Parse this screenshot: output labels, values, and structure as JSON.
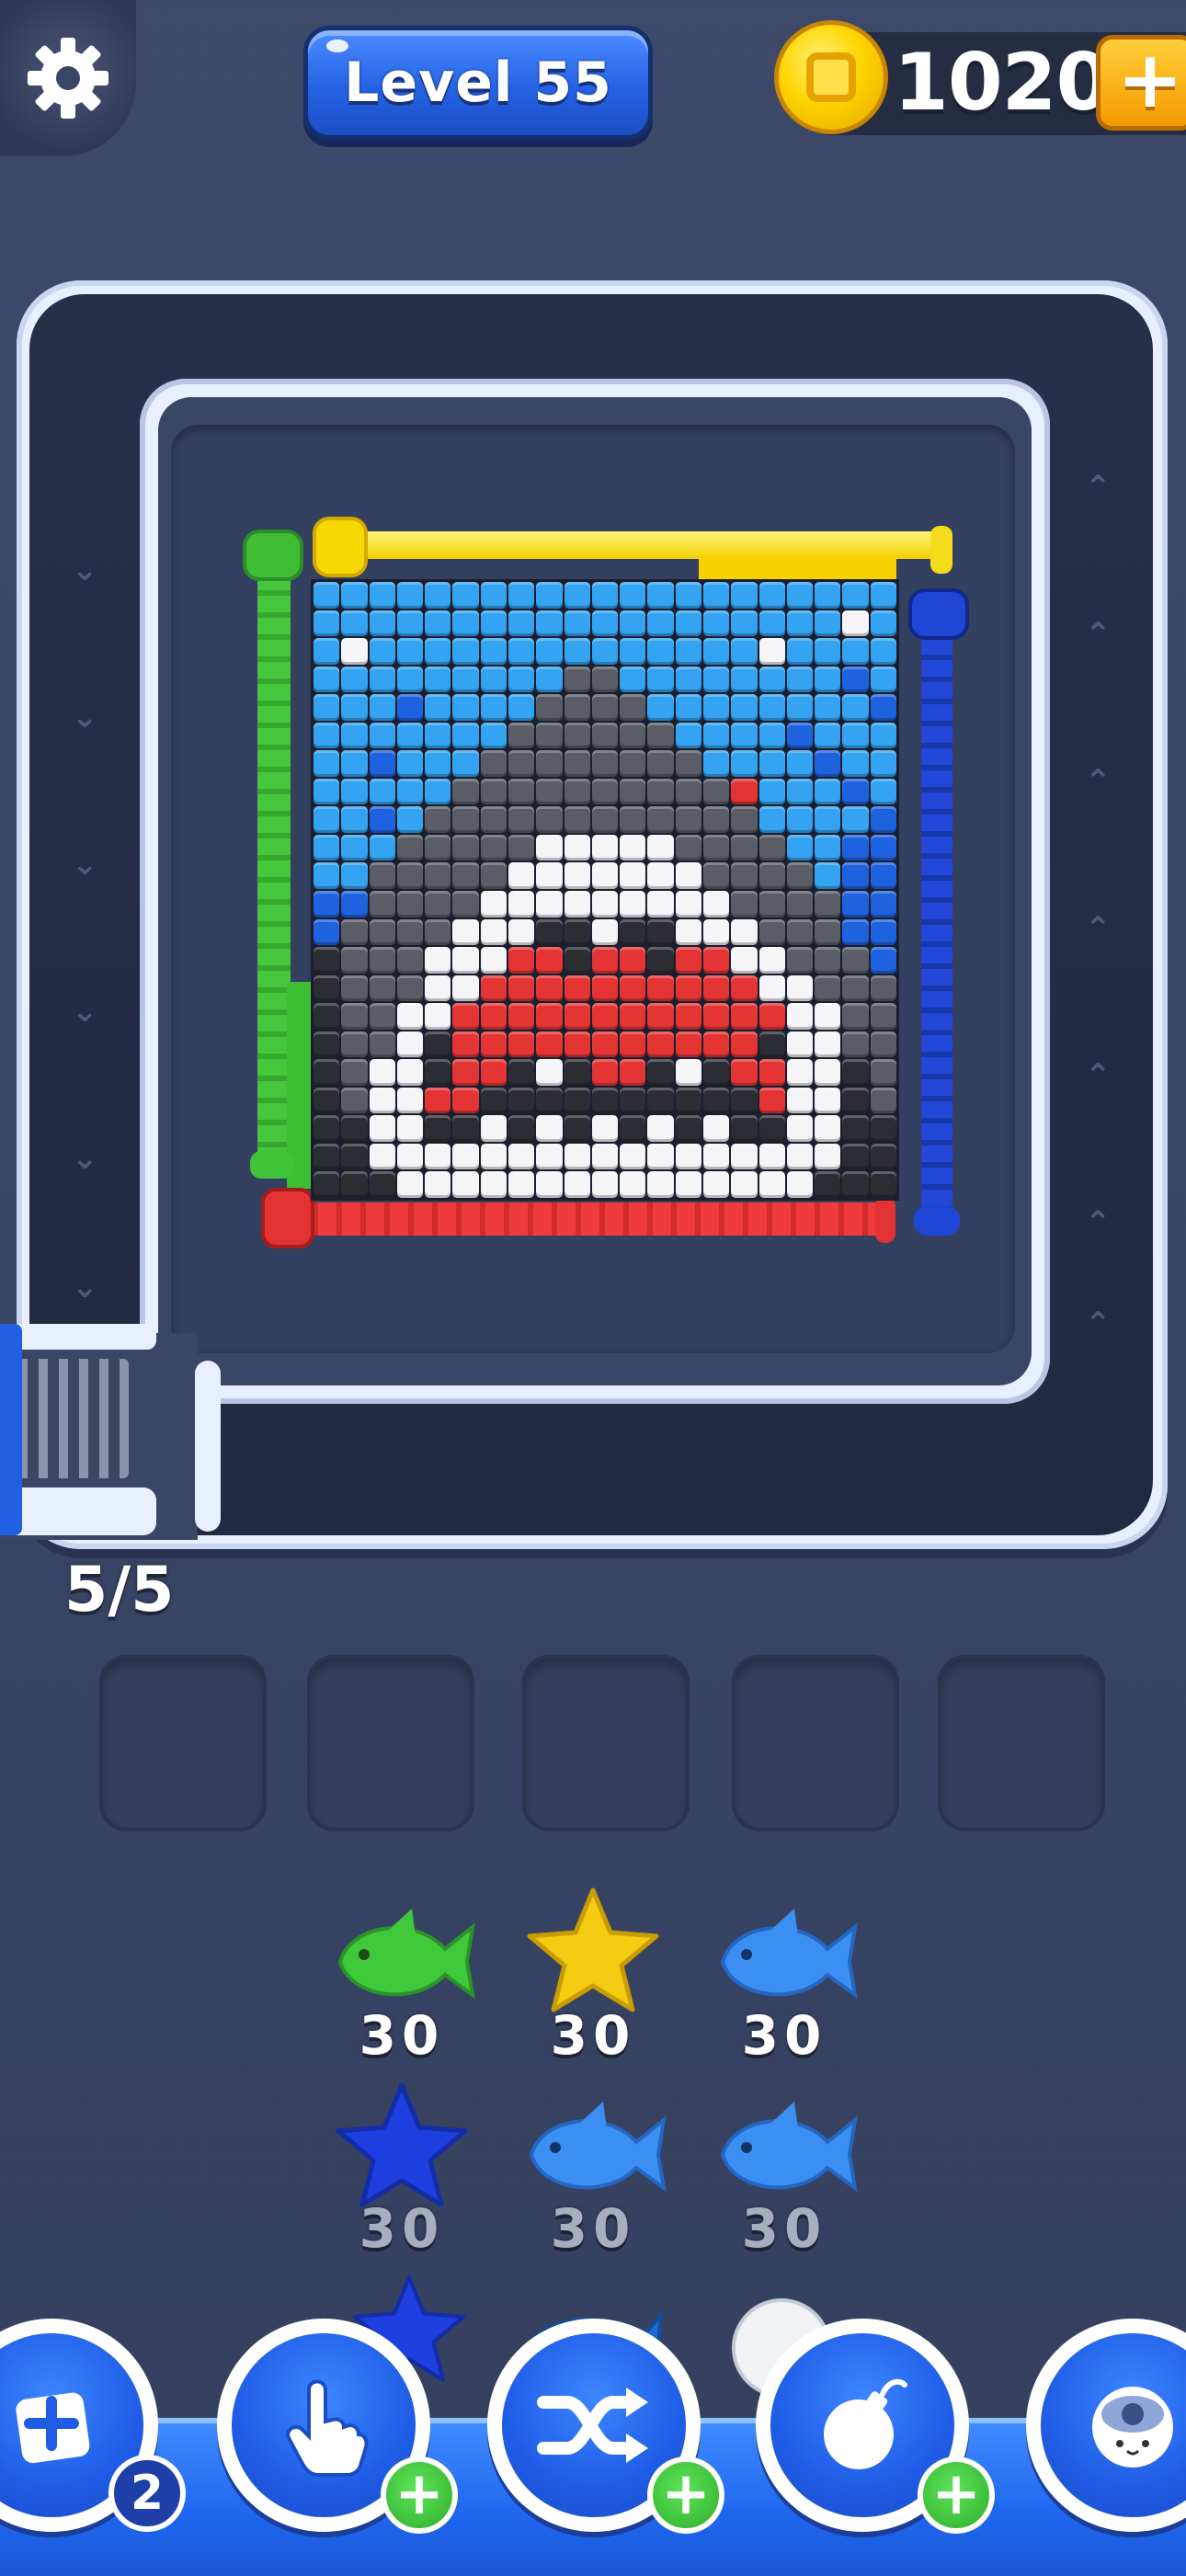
{
  "header": {
    "level_label": "Level 55",
    "coins": "1020",
    "coin_plus": "+"
  },
  "board": {
    "palette": {
      "L": "#33a3f2",
      "D": "#1f62e0",
      "W": "#f5f5f7",
      "K": "#2c2d33",
      "G": "#5a5c66",
      "R": "#e53434",
      "Y": "#f6d000"
    },
    "rows": [
      "LLLLLLLLLLLLLLLLLLLLL",
      "LLLLLLLLLLLLLLLLLLLWL",
      "LWLLLLLLLLLLLLLLWLLLL",
      "LLLLLLLLLGGLLLLLLLLDL",
      "LLLDLLLLGGGGLLLLLLLLD",
      "LLLLLLLGGGGGGLLLLDLLL",
      "LLDLLLGGGGGGGGLLLLDLL",
      "LLLLLGGGGGGGGGGRLLLDL",
      "LLDLGGGGGGGGGGGGLLLLD",
      "LLLGGGGGWWWWWGGGGLLDD",
      "LLGGGGGWWWWWWWGGGGLDD",
      "DDGGGGWWWWWWWWWGGGGDD",
      "DGGGGWWWKKWKKWWWGGGDD",
      "KGGGWWWRRKRRKRRWWGGGD",
      "KGGGWWRRRRRRRRRRWWGGG",
      "KGGWWRRRRRRRRRRRRWWGG",
      "KGGWKRRRRRRRRRRRKWWGG",
      "KGWWKRRKWKRRKWKRRWWKG",
      "KGWWRRKKKKKKKKKKRWWKG",
      "KKWWKKWKWKWKWKWKKWWKK",
      "KKWWWWWWWWWWWWWWWWWKK",
      "KKKWWWWWWWWWWWWWWWKKK"
    ]
  },
  "tray": {
    "counter": "5/5",
    "slot_count": 5
  },
  "queue": {
    "items": [
      {
        "shape": "fish",
        "color": "#3fc83a",
        "count": "30"
      },
      {
        "shape": "star",
        "color": "#f4cc12",
        "count": "30"
      },
      {
        "shape": "fish",
        "color": "#3b8ff2",
        "count": "30"
      },
      {
        "shape": "star",
        "color": "#1d3fe0",
        "count": "30"
      },
      {
        "shape": "fish",
        "color": "#3b8ff2",
        "count": "30"
      },
      {
        "shape": "fish",
        "color": "#3b8ff2",
        "count": "30"
      }
    ]
  },
  "toolbar": {
    "tools": [
      {
        "name": "add-slot-tool",
        "badge": "2"
      },
      {
        "name": "hand-tool",
        "badge": "+"
      },
      {
        "name": "shuffle-tool",
        "badge": "+"
      },
      {
        "name": "bomb-tool",
        "badge": "+"
      },
      {
        "name": "robot-tool",
        "badge": ""
      }
    ]
  }
}
